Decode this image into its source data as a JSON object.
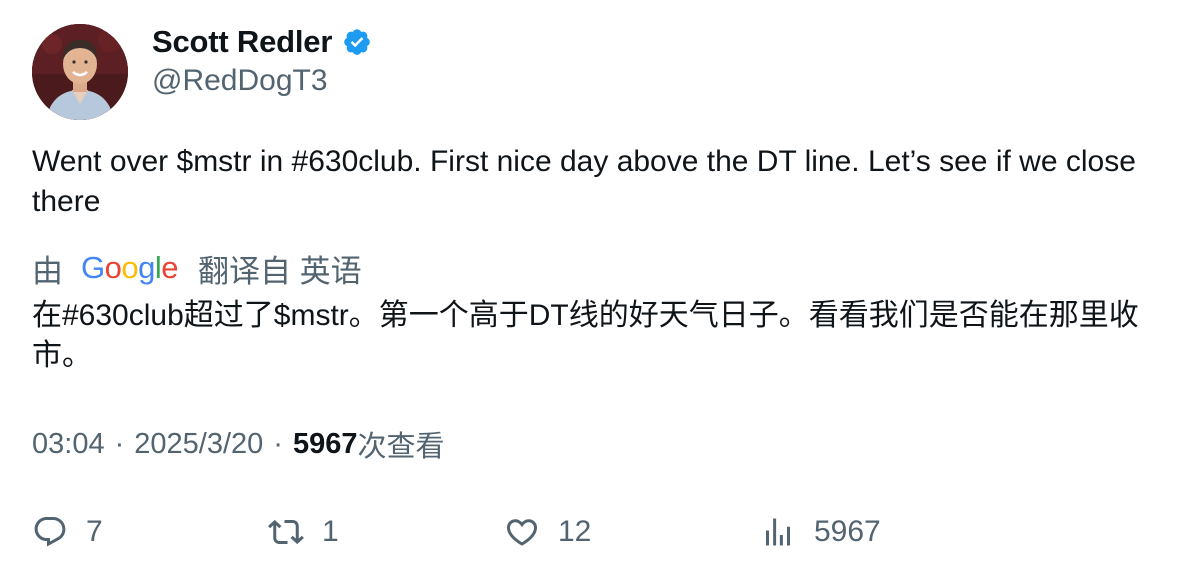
{
  "author": {
    "display_name": "Scott Redler",
    "handle": "@RedDogT3",
    "verified": true,
    "avatar_icon": "profile-photo"
  },
  "tweet": {
    "text": "Went over $mstr in #630club. First nice day above the DT line. Let’s see if we close there"
  },
  "translation": {
    "prefix": "由",
    "provider": "Google",
    "suffix": "翻译自 英语",
    "text": "在#630club超过了$mstr。第一个高于DT线的好天气日子。看看我们是否能在那里收市。"
  },
  "meta": {
    "time": "03:04",
    "separator": "·",
    "date": "2025/3/20",
    "views": "5967",
    "views_label": "次查看"
  },
  "actions": {
    "reply": {
      "icon": "reply-icon",
      "count": "7"
    },
    "retweet": {
      "icon": "retweet-icon",
      "count": "1"
    },
    "like": {
      "icon": "heart-icon",
      "count": "12"
    },
    "views": {
      "icon": "analytics-icon",
      "count": "5967"
    }
  },
  "colors": {
    "text_primary": "#0f1419",
    "text_secondary": "#536471",
    "verified_blue": "#1d9bf0",
    "google_blue": "#4285F4",
    "google_red": "#EA4335",
    "google_yellow": "#FBBC05",
    "google_green": "#34A853"
  }
}
